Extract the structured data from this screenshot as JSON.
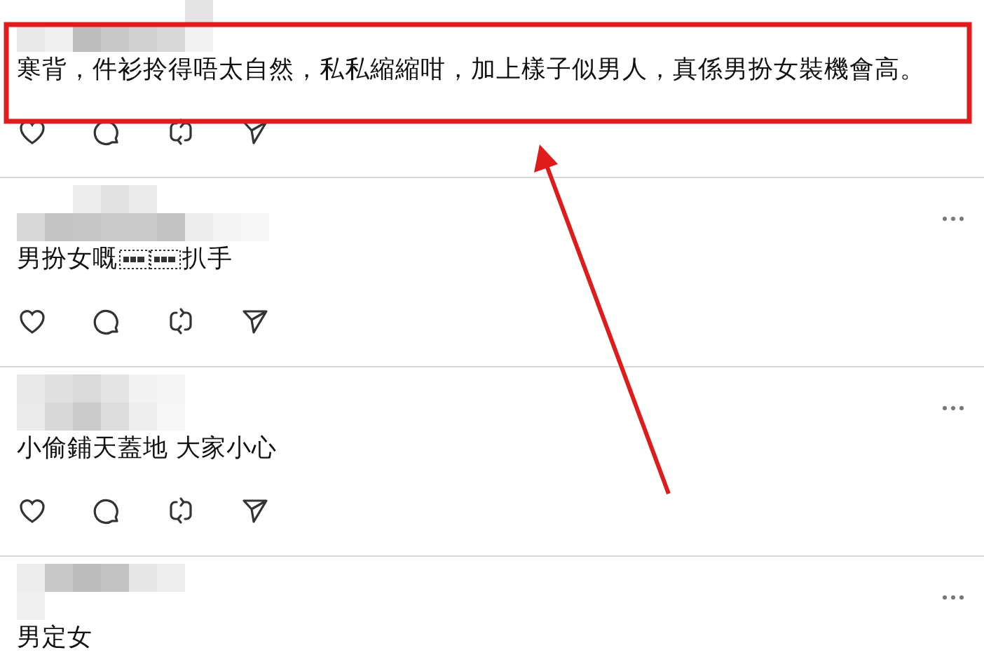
{
  "posts": [
    {
      "text": "寒背，件衫拎得唔太自然，私私縮縮咁，加上樣子似男人，真係男扮女裝機會高。",
      "menu": false,
      "actions": true
    },
    {
      "text": "男扮女嘅",
      "text_after": "扒手",
      "menu": true,
      "actions": true
    },
    {
      "text": "小偷鋪天蓋地 大家小心",
      "menu": true,
      "actions": true
    },
    {
      "text": "男定女",
      "menu": true,
      "actions": false
    }
  ],
  "highlight_box": {
    "color": "#e01b1b"
  },
  "arrow": {
    "color": "#e01b1b"
  }
}
